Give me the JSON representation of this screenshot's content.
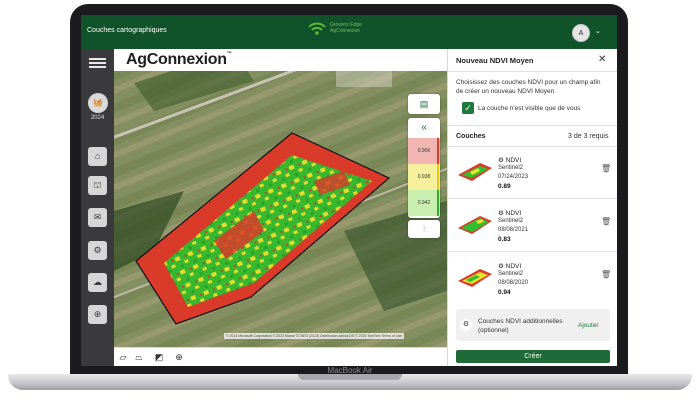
{
  "device": {
    "model": "MacBook Air"
  },
  "topbar": {
    "title": "Couches cartographiques",
    "logo_text": "Growers Edge AgConnexion",
    "avatar_initial": "A"
  },
  "sidebar": {
    "year": "2024"
  },
  "brand": {
    "name": "AgConnexion",
    "tm": "™"
  },
  "map": {
    "copyright": "© 2024 Microsoft Corporation © 2023 Maxar ©CNES (2023) Distribution Airbus DS © 2023 TomTom Terms of Use",
    "legend": [
      {
        "value": "0.906",
        "color": "#f2b6b2",
        "bar": "#e23a2f"
      },
      {
        "value": "0.938",
        "color": "#f6ef9c",
        "bar": "#e8c51a"
      },
      {
        "value": "0.942",
        "color": "#c8efb0",
        "bar": "#2bb02c"
      }
    ]
  },
  "panel": {
    "title": "Nouveau NDVI Moyen",
    "description": "Choisissez des couches NDVI pour un champ afin de créer un nouveau NDVI Moyen",
    "checkbox_label": "La couche n'est visible que de vous",
    "checkbox_checked": true,
    "section_label": "Couches",
    "required": "3 de 3 requis",
    "layers": [
      {
        "type": "NDVI",
        "source": "Sentinel2",
        "date": "07/24/2023",
        "value": "0.89"
      },
      {
        "type": "NDVI",
        "source": "Sentinel2",
        "date": "08/08/2021",
        "value": "0.83"
      },
      {
        "type": "NDVI",
        "source": "Sentinel2",
        "date": "08/08/2020",
        "value": "0.94"
      }
    ],
    "extra_label": "Couches NDVI additionnelles (optionnel)",
    "add_label": "Ajouter",
    "create_label": "Créer"
  }
}
